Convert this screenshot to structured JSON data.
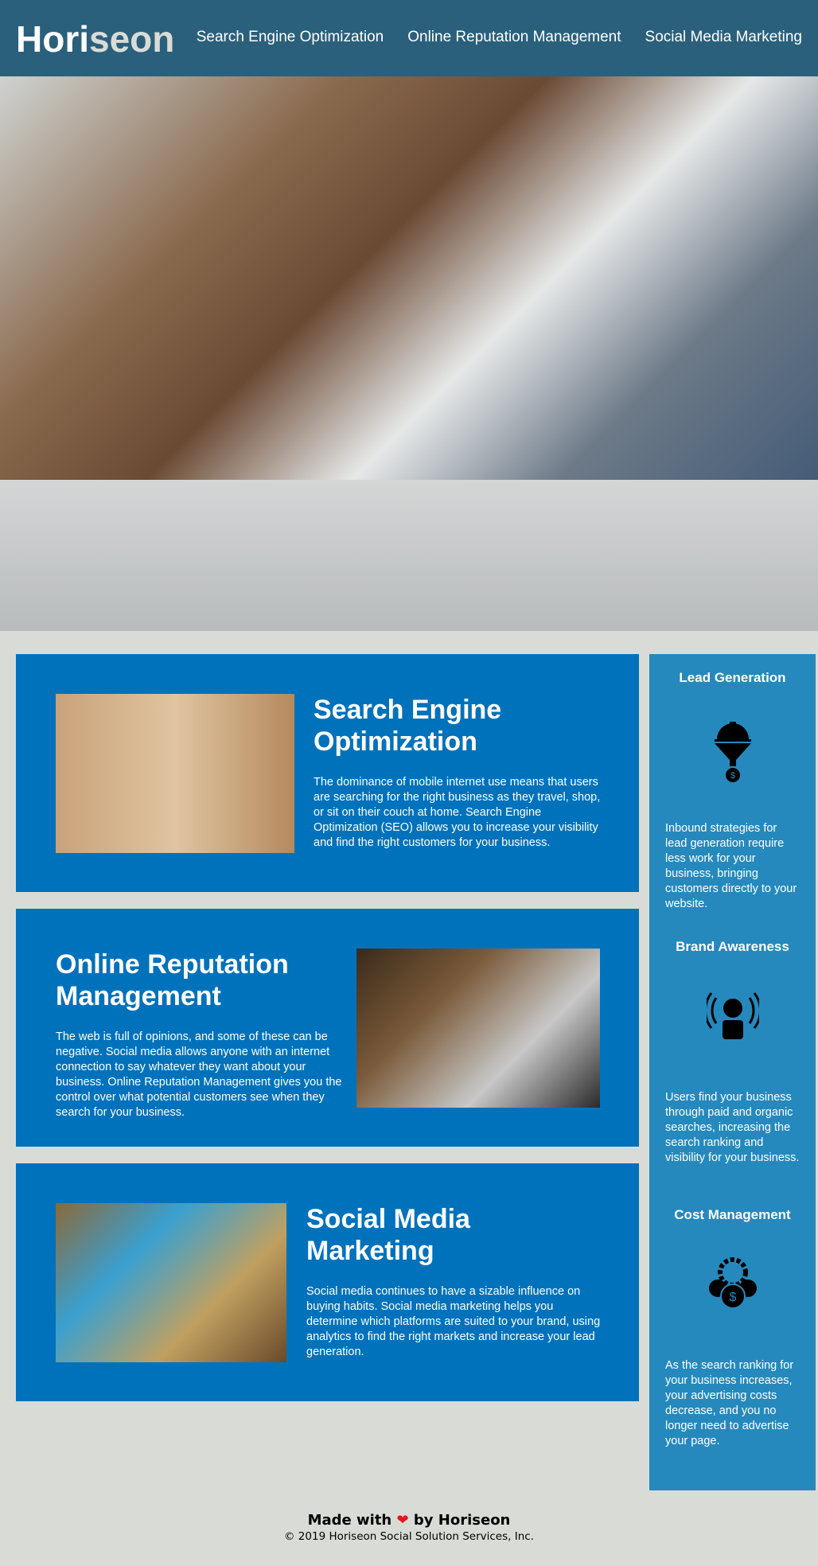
{
  "header": {
    "logo_prefix": "Hori",
    "logo_suffix": "seon",
    "nav": [
      "Search Engine Optimization",
      "Online Reputation Management",
      "Social Media Marketing"
    ]
  },
  "cards": [
    {
      "title": "Search Engine Optimization",
      "text": "The dominance of mobile internet use means that users are searching for the right business as they travel, shop, or sit on their couch at home. Search Engine Optimization (SEO) allows you to increase your visibility and find the right customers for your business."
    },
    {
      "title": "Online Reputation Management",
      "text": "The web is full of opinions, and some of these can be negative. Social media allows anyone with an internet connection to say whatever they want about your business. Online Reputation Management gives you the control over what potential customers see when they search for your business."
    },
    {
      "title": "Social Media Marketing",
      "text": "Social media continues to have a sizable influence on buying habits. Social media marketing helps you determine which platforms are suited to your brand, using analytics to find the right markets and increase your lead generation."
    }
  ],
  "benefits": [
    {
      "title": "Lead Generation",
      "icon": "funnel-gear-icon",
      "text": "Inbound strategies for lead generation require less work for your business, bringing customers directly to your website."
    },
    {
      "title": "Brand Awareness",
      "icon": "lightbulb-person-icon",
      "text": "Users find your business through paid and organic searches, increasing the search ranking and visibility for your business."
    },
    {
      "title": "Cost Management",
      "icon": "coins-gear-icon",
      "text": "As the search ranking for your business increases, your advertising costs decrease, and you no longer need to advertise your page."
    }
  ],
  "footer": {
    "made_prefix": "Made with",
    "made_suffix": "by Horiseon",
    "copyright": "© 2019 Horiseon Social Solution Services, Inc."
  }
}
